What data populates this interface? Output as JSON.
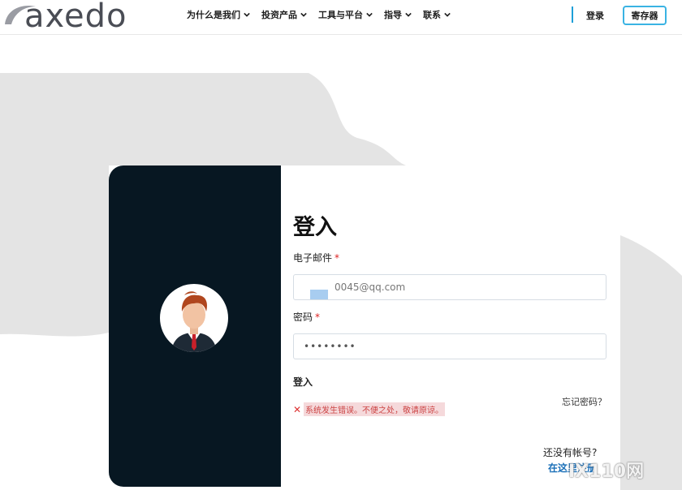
{
  "header": {
    "logo_text": "axedo",
    "nav": [
      {
        "label": "为什么是我们"
      },
      {
        "label": "投资产品"
      },
      {
        "label": "工具与平台"
      },
      {
        "label": "指导"
      },
      {
        "label": "联系"
      }
    ],
    "login_label": "登录",
    "register_label": "寄存器"
  },
  "form": {
    "title": "登入",
    "email_label": "电子邮件",
    "email_value": "0045@qq.com",
    "password_label": "密码",
    "password_value": "••••••••",
    "required_mark": "*",
    "submit_label": "登入",
    "forgot_label": "忘记密码？",
    "error_text": "系统发生错误。不便之处，敬请原谅。",
    "no_account_label": "还没有帐号?",
    "register_here_label": "在这里注册"
  },
  "watermark": "IX110网",
  "colors": {
    "left_panel": "#071722",
    "accent": "#3ab3e3",
    "link": "#1a6fb8",
    "error": "#d33333"
  }
}
